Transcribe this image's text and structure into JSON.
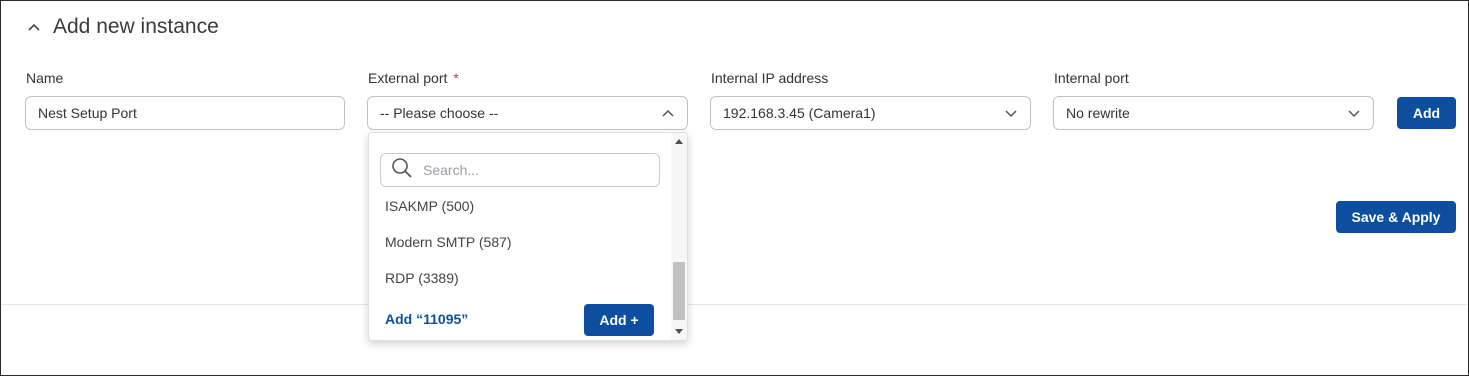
{
  "section": {
    "title": "Add new instance"
  },
  "fields": {
    "name": {
      "label": "Name",
      "value": "Nest Setup Port"
    },
    "external_port": {
      "label": "External port",
      "required_mark": "*",
      "value": "-- Please choose --"
    },
    "internal_ip": {
      "label": "Internal IP address",
      "value": "192.168.3.45 (Camera1)"
    },
    "internal_port": {
      "label": "Internal port",
      "value": "No rewrite"
    }
  },
  "buttons": {
    "add": "Add",
    "save_apply": "Save & Apply"
  },
  "dropdown": {
    "search_placeholder": "Search...",
    "options": [
      "ISAKMP (500)",
      "Modern SMTP (587)",
      "RDP (3389)"
    ],
    "add_custom_label": "Add “11095”",
    "add_button": "Add +"
  },
  "icons": {
    "collapse": "chevron-up-icon",
    "select_open": "chevron-up-icon",
    "select_closed": "chevron-down-icon",
    "search": "search-icon"
  },
  "colors": {
    "primary": "#0d4f9e",
    "required": "#d6333d",
    "border": "#bfc3c7"
  }
}
